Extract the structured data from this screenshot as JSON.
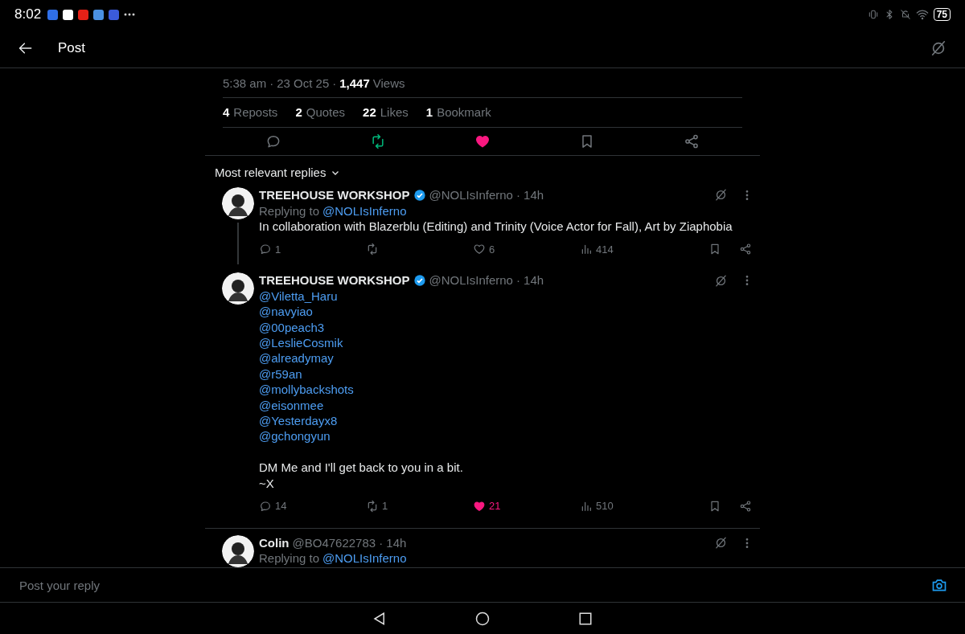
{
  "status_bar": {
    "time": "8:02",
    "battery": "75"
  },
  "header": {
    "title": "Post"
  },
  "post": {
    "time": "5:38 am",
    "separator_1": "·",
    "date": "23 Oct 25",
    "separator_2": "·",
    "views_count": "1,447",
    "views_label": "Views",
    "stats": [
      {
        "count": "4",
        "label": "Reposts"
      },
      {
        "count": "2",
        "label": "Quotes"
      },
      {
        "count": "22",
        "label": "Likes"
      },
      {
        "count": "1",
        "label": "Bookmark"
      }
    ],
    "actions": {
      "reposted": true,
      "liked": true,
      "bookmarked": false
    }
  },
  "replies_sort": {
    "label": "Most relevant replies"
  },
  "replies": [
    {
      "name": "TREEHOUSE WORKSHOP",
      "verified": true,
      "handle": "@NOLIsInferno",
      "time": "· 14h",
      "replying_label": "Replying to",
      "replying_to": "@NOLIsInferno",
      "threaded": true,
      "body": [
        {
          "kind": "text",
          "lines": [
            "In collaboration with Blazerblu (Editing) and Trinity (Voice Actor for Fall), Art by Ziaphobia"
          ]
        }
      ],
      "actions": {
        "reply_count": "1",
        "like_count": "6",
        "views": "414",
        "liked": false
      }
    },
    {
      "name": "TREEHOUSE WORKSHOP",
      "verified": true,
      "handle": "@NOLIsInferno",
      "time": "· 14h",
      "threaded": false,
      "body": [
        {
          "kind": "mentions",
          "lines": [
            "@Viletta_Haru",
            "@navyiao",
            "@00peach3",
            "@LeslieCosmik",
            "@alreadymay",
            "@r59an",
            "@mollybackshots",
            "@eisonmee",
            "@Yesterdayx8",
            "@gchongyun"
          ]
        },
        {
          "kind": "text",
          "lines": [
            "DM Me and I'll get back to you in a bit.",
            "~X"
          ]
        }
      ],
      "actions": {
        "reply_count": "14",
        "repost_count": "1",
        "like_count": "21",
        "views": "510",
        "liked": true
      }
    },
    {
      "name": "Colin",
      "verified": false,
      "handle": "@BO47622783",
      "time": "· 14h",
      "replying_label": "Replying to",
      "replying_to": "@NOLIsInferno",
      "threaded": false
    }
  ],
  "composer": {
    "placeholder": "Post your reply"
  }
}
